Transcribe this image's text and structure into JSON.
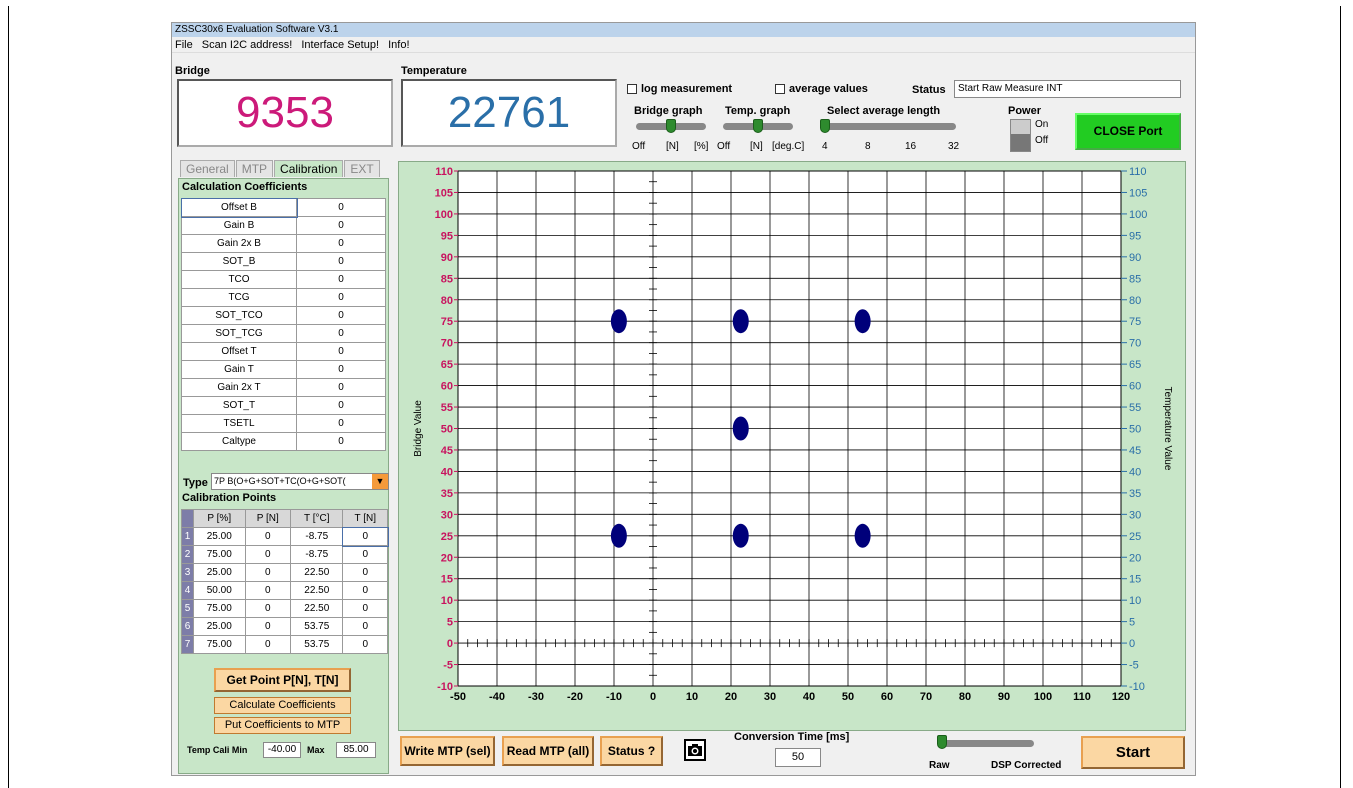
{
  "window": {
    "title": "ZSSC30x6 Evaluation Software V3.1"
  },
  "menu": [
    "File",
    "Scan I2C address!",
    "Interface Setup!",
    "Info!"
  ],
  "bridge": {
    "label": "Bridge",
    "value": "9353",
    "color": "#cc1a7a"
  },
  "temperature": {
    "label": "Temperature",
    "value": "22761",
    "color": "#2a6fa8"
  },
  "options": {
    "log_measurement": "log measurement",
    "average_values": "average values"
  },
  "status": {
    "label": "Status",
    "value": "Start Raw Measure INT"
  },
  "bridge_graph": {
    "label": "Bridge graph",
    "ticks": [
      "Off",
      "[N]",
      "[%]"
    ]
  },
  "temp_graph": {
    "label": "Temp. graph",
    "ticks": [
      "Off",
      "[N]",
      "[deg.C]"
    ]
  },
  "avg_length": {
    "label": "Select average length",
    "ticks": [
      "4",
      "8",
      "16",
      "32"
    ]
  },
  "power": {
    "label": "Power",
    "on": "On",
    "off": "Off"
  },
  "close_port": "CLOSE Port",
  "tabs": [
    "General",
    "MTP",
    "Calibration",
    "EXT"
  ],
  "calc_coeffs": {
    "title": "Calculation Coefficients",
    "rows": [
      [
        "Offset B",
        "0"
      ],
      [
        "Gain B",
        "0"
      ],
      [
        "Gain 2x B",
        "0"
      ],
      [
        "SOT_B",
        "0"
      ],
      [
        "TCO",
        "0"
      ],
      [
        "TCG",
        "0"
      ],
      [
        "SOT_TCO",
        "0"
      ],
      [
        "SOT_TCG",
        "0"
      ],
      [
        "Offset T",
        "0"
      ],
      [
        "Gain T",
        "0"
      ],
      [
        "Gain 2x T",
        "0"
      ],
      [
        "SOT_T",
        "0"
      ],
      [
        "TSETL",
        "0"
      ],
      [
        "Caltype",
        "0"
      ]
    ]
  },
  "type": {
    "label": "Type",
    "value": "7P B(O+G+SOT+TC(O+G+SOT("
  },
  "cal_points": {
    "title": "Calibration Points",
    "headers": [
      "P [%]",
      "P [N]",
      "T [°C]",
      "T [N]"
    ],
    "rows": [
      [
        "1",
        "25.00",
        "0",
        "-8.75",
        "0"
      ],
      [
        "2",
        "75.00",
        "0",
        "-8.75",
        "0"
      ],
      [
        "3",
        "25.00",
        "0",
        "22.50",
        "0"
      ],
      [
        "4",
        "50.00",
        "0",
        "22.50",
        "0"
      ],
      [
        "5",
        "75.00",
        "0",
        "22.50",
        "0"
      ],
      [
        "6",
        "25.00",
        "0",
        "53.75",
        "0"
      ],
      [
        "7",
        "75.00",
        "0",
        "53.75",
        "0"
      ]
    ]
  },
  "buttons": {
    "get_point": "Get Point P[N], T[N]",
    "calc_coeffs": "Calculate Coefficients",
    "put_coeffs": "Put Coefficients to MTP",
    "write_mtp": "Write MTP (sel)",
    "read_mtp": "Read MTP (all)",
    "status": "Status ?",
    "start": "Start"
  },
  "temp_cali": {
    "min_label": "Temp Cali Min",
    "min_value": "-40.00",
    "max_label": "Max",
    "max_value": "85.00"
  },
  "conversion": {
    "label": "Conversion Time [ms]",
    "value": "50"
  },
  "raw_dsp": {
    "raw": "Raw",
    "dsp": "DSP Corrected"
  },
  "chart_data": {
    "type": "scatter",
    "ylabel": "Bridge Value",
    "y2label": "Temperature Value",
    "xlim": [
      -50,
      120
    ],
    "ylim": [
      -10,
      110
    ],
    "xticks": [
      -50,
      -40,
      -30,
      -20,
      -10,
      0,
      10,
      20,
      30,
      40,
      50,
      60,
      70,
      80,
      90,
      100,
      110,
      120
    ],
    "yticks": [
      -10,
      -5,
      0,
      5,
      10,
      15,
      20,
      25,
      30,
      35,
      40,
      45,
      50,
      55,
      60,
      65,
      70,
      75,
      80,
      85,
      90,
      95,
      100,
      105,
      110
    ],
    "grid": true,
    "point_color": "#00007a",
    "left_tick_color": "#c8145f",
    "right_tick_color": "#2a6fa8",
    "points": [
      {
        "x": -8.75,
        "y": 75
      },
      {
        "x": 22.5,
        "y": 75
      },
      {
        "x": 53.75,
        "y": 75
      },
      {
        "x": 22.5,
        "y": 50
      },
      {
        "x": -8.75,
        "y": 25
      },
      {
        "x": 22.5,
        "y": 25
      },
      {
        "x": 53.75,
        "y": 25
      }
    ]
  }
}
